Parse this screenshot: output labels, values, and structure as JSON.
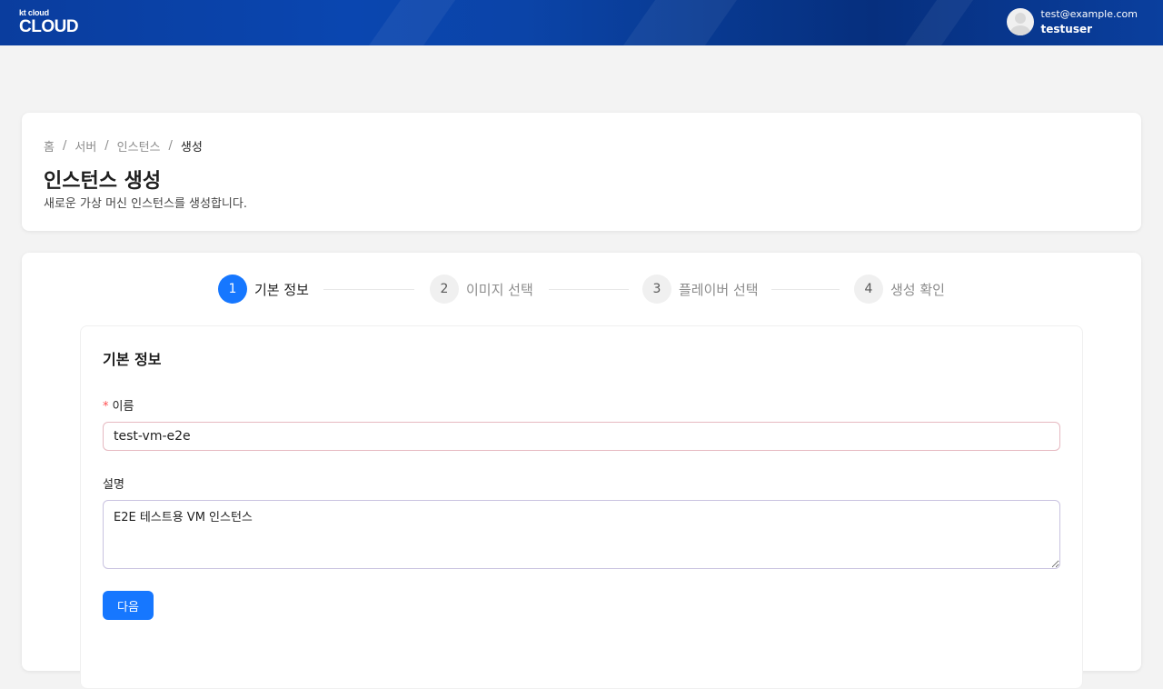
{
  "header": {
    "logo_small": "kt cloud",
    "logo_main": "CLOUD",
    "user_email": "test@example.com",
    "user_name": "testuser"
  },
  "breadcrumb": {
    "items": [
      "홈",
      "서버",
      "인스턴스",
      "생성"
    ],
    "separator": "/"
  },
  "page": {
    "title": "인스턴스 생성",
    "subtitle": "새로운 가상 머신 인스턴스를 생성합니다."
  },
  "steps": [
    {
      "number": "1",
      "label": "기본 정보",
      "state": "active"
    },
    {
      "number": "2",
      "label": "이미지 선택",
      "state": "waiting"
    },
    {
      "number": "3",
      "label": "플레이버 선택",
      "state": "waiting"
    },
    {
      "number": "4",
      "label": "생성 확인",
      "state": "waiting"
    }
  ],
  "form": {
    "section_title": "기본 정보",
    "name_label": "이름",
    "name_required_mark": "*",
    "name_value": "test-vm-e2e",
    "description_label": "설명",
    "description_value": "E2E 테스트용 VM 인스턴스",
    "next_button": "다음"
  },
  "colors": {
    "primary": "#1677ff",
    "header_blue": "#0a46b0",
    "required": "#ff4d4f"
  }
}
